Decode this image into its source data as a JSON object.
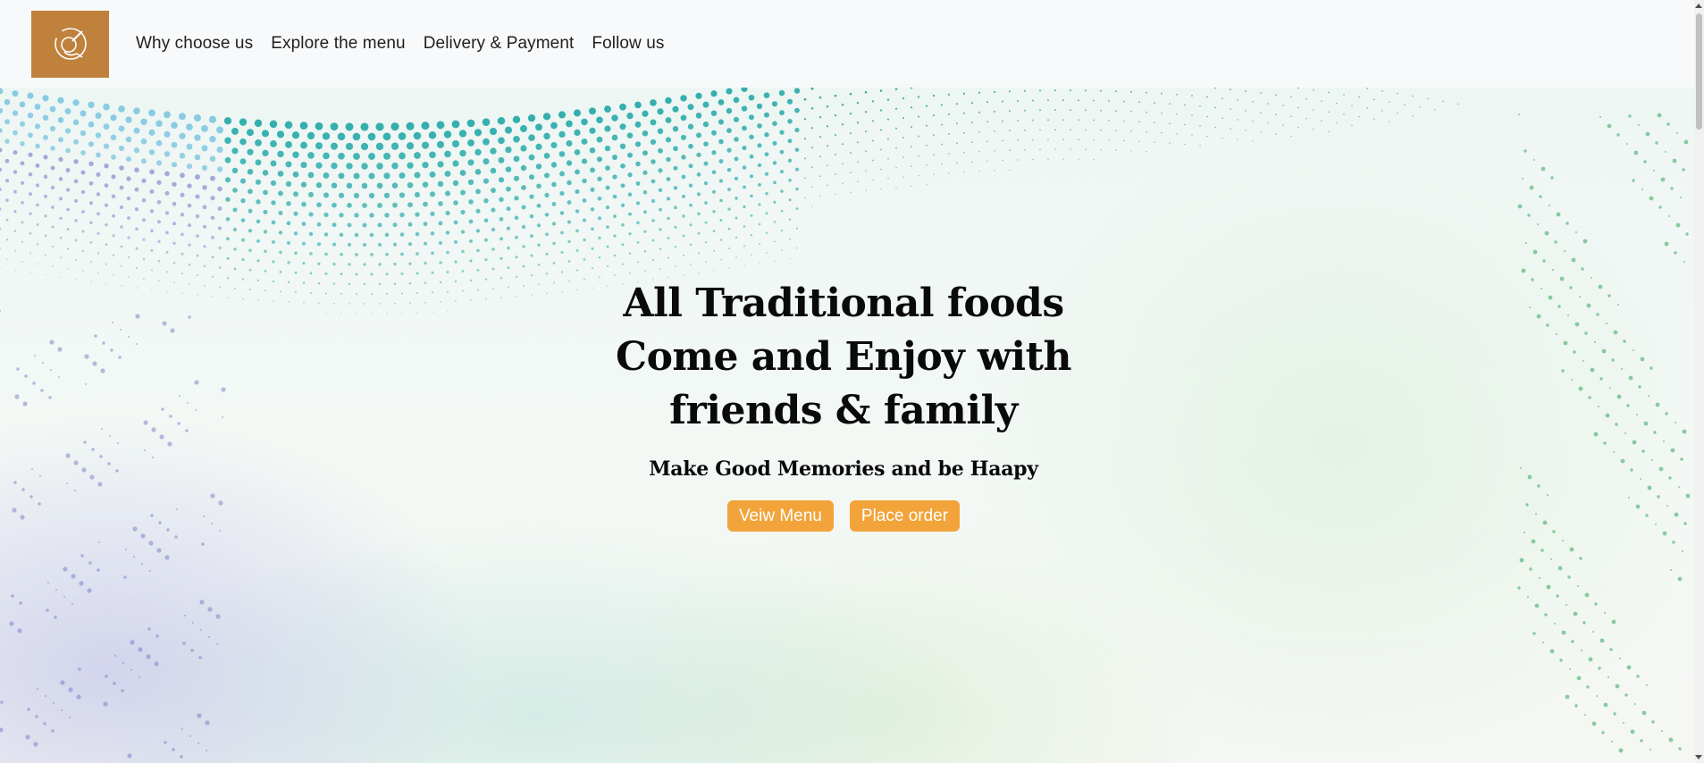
{
  "navbar": {
    "logo_icon": "dish-utensils-icon",
    "links": [
      {
        "label": "Why choose us"
      },
      {
        "label": "Explore the menu"
      },
      {
        "label": "Delivery & Payment"
      },
      {
        "label": "Follow us"
      }
    ]
  },
  "hero": {
    "title_lines": [
      "All Traditional foods",
      "Come and Enjoy with",
      "friends & family"
    ],
    "subtitle": "Make Good Memories and be Haapy",
    "buttons": [
      {
        "label": "Veiw Menu"
      },
      {
        "label": "Place order"
      }
    ]
  },
  "colors": {
    "logo_bg": "#bf813c",
    "button_bg": "#f2a43a",
    "navbar_bg": "#f8f9fa"
  }
}
